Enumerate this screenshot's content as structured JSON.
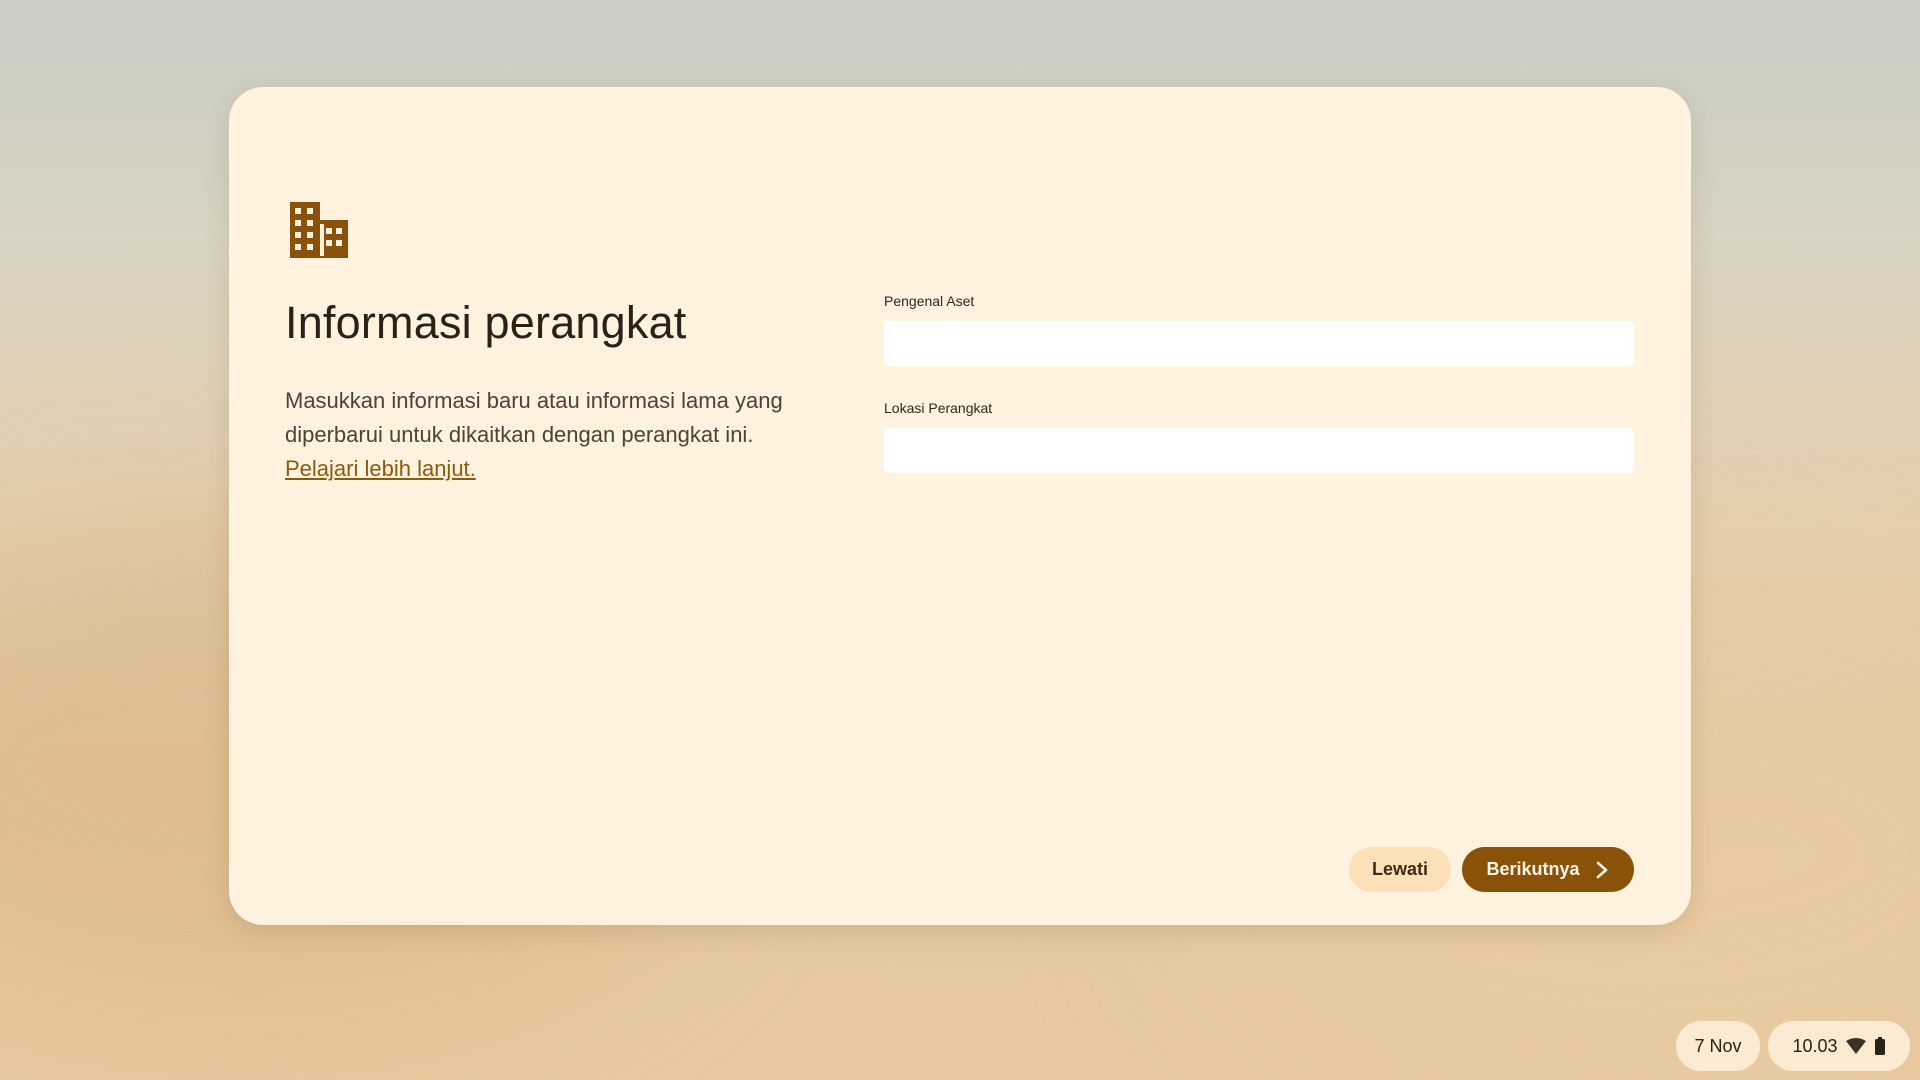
{
  "dialog": {
    "title": "Informasi perangkat",
    "description": "Masukkan informasi baru atau informasi lama yang diperbarui untuk dikaitkan dengan perangkat ini.",
    "learn_more_link": "Pelajari lebih lanjut.",
    "icon": "building-icon",
    "fields": [
      {
        "label": "Pengenal Aset",
        "value": ""
      },
      {
        "label": "Lokasi Perangkat",
        "value": ""
      }
    ],
    "skip_button": "Lewati",
    "next_button": "Berikutnya"
  },
  "shelf": {
    "date": "7 Nov",
    "time": "10.03",
    "icons": [
      "wifi-icon",
      "battery-icon"
    ]
  },
  "colors": {
    "accent": "#8a5208",
    "dialog_background": "#fff2df",
    "secondary_button": "#fde0b8",
    "link": "#8d5a0b"
  }
}
